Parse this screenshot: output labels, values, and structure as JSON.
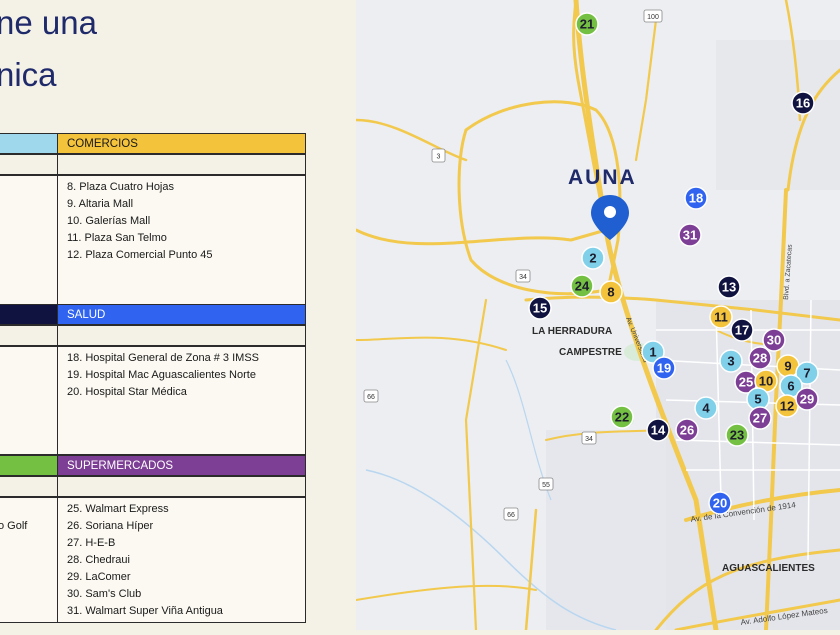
{
  "heading": {
    "line1": "ne una",
    "line2": "nica"
  },
  "table": {
    "comercios": {
      "header": "COMERCIOS",
      "items": [
        "8.  Plaza Cuatro Hojas",
        "9.  Altaria Mall",
        "10. Galerías Mall",
        "11. Plaza San Telmo",
        "12. Plaza Comercial Punto 45"
      ]
    },
    "salud": {
      "header": "SALUD",
      "items": [
        "18. Hospital General de Zona # 3 IMSS",
        "19. Hospital Mac Aguascalientes Norte",
        "20. Hospital Star Médica"
      ]
    },
    "supermercados": {
      "header": "SUPERMERCADOS",
      "items": [
        "25. Walmart Express",
        "26. Soriana Híper",
        "27. H-E-B",
        "28. Chedraui",
        "29. LaComer",
        "30. Sam's Club",
        "31. Walmart Super Viña Antigua"
      ]
    },
    "left_fragment": "o Golf"
  },
  "colors": {
    "comercios": "#f3c33c",
    "salud": "#2f63f0",
    "supermercados": "#7d3f95",
    "education": "#7fd0e8",
    "navy": "#10133f",
    "green": "#74c043",
    "route": "#f2c94c",
    "pin": "#1f5fd1"
  },
  "map": {
    "brand": "AUNA",
    "places": {
      "herradura": "LA HERRADURA",
      "campestre": "CAMPESTRE",
      "aguascalientes": "AGUASCALIENTES"
    },
    "roads": {
      "convencion": "Av. de la Convención de 1914",
      "zacatecas": "Blvd. a Zacatecas",
      "adolfo": "Av. Adolfo López Mateos",
      "universidad": "Av. Universidad"
    },
    "shields": [
      "100",
      "3",
      "34",
      "34",
      "66",
      "66",
      "55"
    ],
    "markers": [
      {
        "n": "21",
        "cat": "green",
        "label": "21"
      },
      {
        "n": "16",
        "cat": "navy",
        "label": "16"
      },
      {
        "n": "18",
        "cat": "salud",
        "label": "18"
      },
      {
        "n": "31",
        "cat": "supermercados",
        "label": "31"
      },
      {
        "n": "2",
        "cat": "education",
        "label": "2"
      },
      {
        "n": "24",
        "cat": "green",
        "label": "24"
      },
      {
        "n": "8",
        "cat": "comercios",
        "label": "8"
      },
      {
        "n": "13",
        "cat": "navy",
        "label": "13"
      },
      {
        "n": "15",
        "cat": "navy",
        "label": "15"
      },
      {
        "n": "11",
        "cat": "comercios",
        "label": "11"
      },
      {
        "n": "17",
        "cat": "navy",
        "label": "17"
      },
      {
        "n": "30",
        "cat": "supermercados",
        "label": "30"
      },
      {
        "n": "1",
        "cat": "education",
        "label": "1"
      },
      {
        "n": "19",
        "cat": "salud",
        "label": "19"
      },
      {
        "n": "3",
        "cat": "education",
        "label": "3"
      },
      {
        "n": "28",
        "cat": "supermercados",
        "label": "28"
      },
      {
        "n": "9",
        "cat": "comercios",
        "label": "9"
      },
      {
        "n": "7",
        "cat": "education",
        "label": "7"
      },
      {
        "n": "25",
        "cat": "supermercados",
        "label": "25"
      },
      {
        "n": "10",
        "cat": "comercios",
        "label": "10"
      },
      {
        "n": "6",
        "cat": "education",
        "label": "6"
      },
      {
        "n": "5",
        "cat": "education",
        "label": "5"
      },
      {
        "n": "12",
        "cat": "comercios",
        "label": "12"
      },
      {
        "n": "29",
        "cat": "supermercados",
        "label": "29"
      },
      {
        "n": "4",
        "cat": "education",
        "label": "4"
      },
      {
        "n": "22",
        "cat": "green",
        "label": "22"
      },
      {
        "n": "27",
        "cat": "supermercados",
        "label": "27"
      },
      {
        "n": "14",
        "cat": "navy",
        "label": "14"
      },
      {
        "n": "26",
        "cat": "supermercados",
        "label": "26"
      },
      {
        "n": "23",
        "cat": "green",
        "label": "23"
      },
      {
        "n": "20",
        "cat": "salud",
        "label": "20"
      }
    ]
  }
}
